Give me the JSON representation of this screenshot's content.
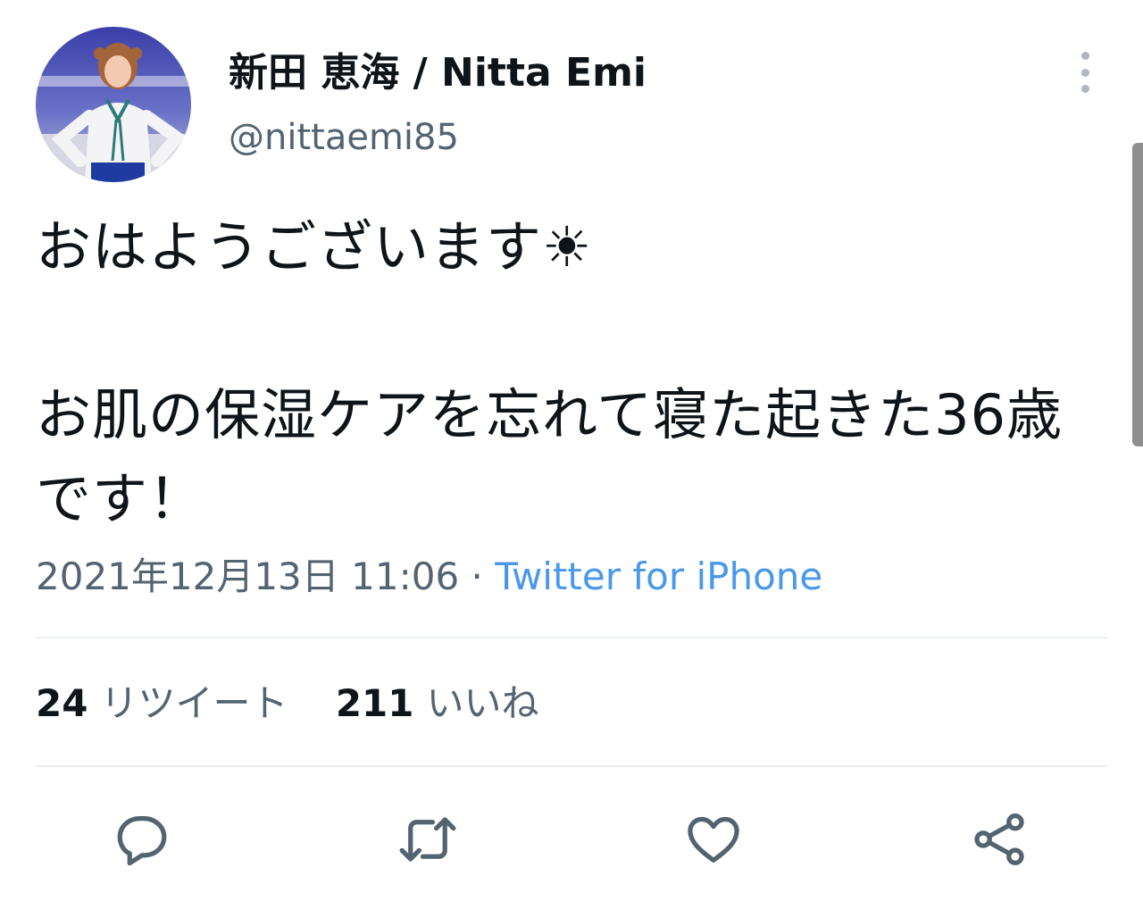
{
  "user": {
    "display_name": "新田 恵海 / Nitta Emi",
    "handle": "@nittaemi85"
  },
  "tweet": {
    "text": "おはようございます☀︎\n\nお肌の保湿ケアを忘れて寝た起きた36歳です！",
    "timestamp": "2021年12月13日 11:06",
    "separator": " · ",
    "source": "Twitter for iPhone"
  },
  "stats": {
    "retweets_count": "24",
    "retweets_label": "リツイート",
    "likes_count": "211",
    "likes_label": "いいね"
  },
  "actions": [
    "reply",
    "retweet",
    "like",
    "share"
  ],
  "colors": {
    "text": "#0f1419",
    "secondary": "#536471",
    "link": "#4a99e9",
    "divider": "#eceff1"
  }
}
